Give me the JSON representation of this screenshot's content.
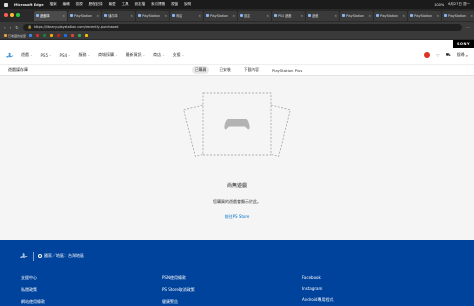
{
  "menubar": {
    "app_name": "Microsoft Edge",
    "items": [
      "檔案",
      "編輯",
      "檢視",
      "歷程記錄",
      "最愛",
      "工具",
      "設定檔",
      "索引標籤",
      "視窗",
      "說明"
    ],
    "battery": "100%",
    "clock": "6月27日 週一"
  },
  "tabs": [
    {
      "label": "遊戲庫",
      "active": true
    },
    {
      "label": "PlayStation"
    },
    {
      "label": "儲存庫"
    },
    {
      "label": "PlayStation"
    },
    {
      "label": "商店"
    },
    {
      "label": "PlayStation"
    },
    {
      "label": "設定"
    },
    {
      "label": "PS4 遊戲"
    },
    {
      "label": "遊戲"
    },
    {
      "label": "PlayStation"
    },
    {
      "label": "PlayStation"
    },
    {
      "label": "PlayStation"
    },
    {
      "label": "PlayStation"
    }
  ],
  "address": {
    "url": "https://library.playstation.com/recently-purchased"
  },
  "bookmarks": [
    {
      "label": "已收藏的最愛",
      "color": "#e8a33d"
    },
    {
      "label": "",
      "color": "#4285f4"
    },
    {
      "label": "",
      "color": "#d93025"
    },
    {
      "label": "",
      "color": "#188038"
    },
    {
      "label": "",
      "color": "#f9ab00"
    },
    {
      "label": "",
      "color": "#c5221f"
    },
    {
      "label": "",
      "color": "#1a73e8"
    },
    {
      "label": "",
      "color": "#ea4335"
    },
    {
      "label": "",
      "color": "#34a853"
    },
    {
      "label": "",
      "color": "#fbbc04"
    }
  ],
  "psnav": {
    "sony": "SONY",
    "items": [
      "遊戲",
      "PS5",
      "PS4",
      "服務",
      "商城採購",
      "最新資訊",
      "商店",
      "支援"
    ],
    "search_label": "搜尋"
  },
  "subnav": {
    "title": "遊戲媒存庫",
    "tabs": [
      {
        "label": "已購買",
        "active": true
      },
      {
        "label": "已安裝"
      },
      {
        "label": "下載內容"
      },
      {
        "label": "PlayStation Plus"
      }
    ]
  },
  "empty": {
    "title": "尚無遊戲",
    "description": "您購買的遊戲會顯示於此。",
    "link": "前往PS Store"
  },
  "footer": {
    "region": "國家／地區：台灣地區",
    "col1": [
      "支援中心",
      "私隱政策",
      "網站使用條款"
    ],
    "col2": [
      "PSN使用條款",
      "PS Store取消政策",
      "健康警告"
    ],
    "col3": [
      "Facebook",
      "Instagram",
      "Android專用程式"
    ]
  },
  "colors": {
    "ps_blue": "#0070cc",
    "footer_blue": "#00439c"
  }
}
